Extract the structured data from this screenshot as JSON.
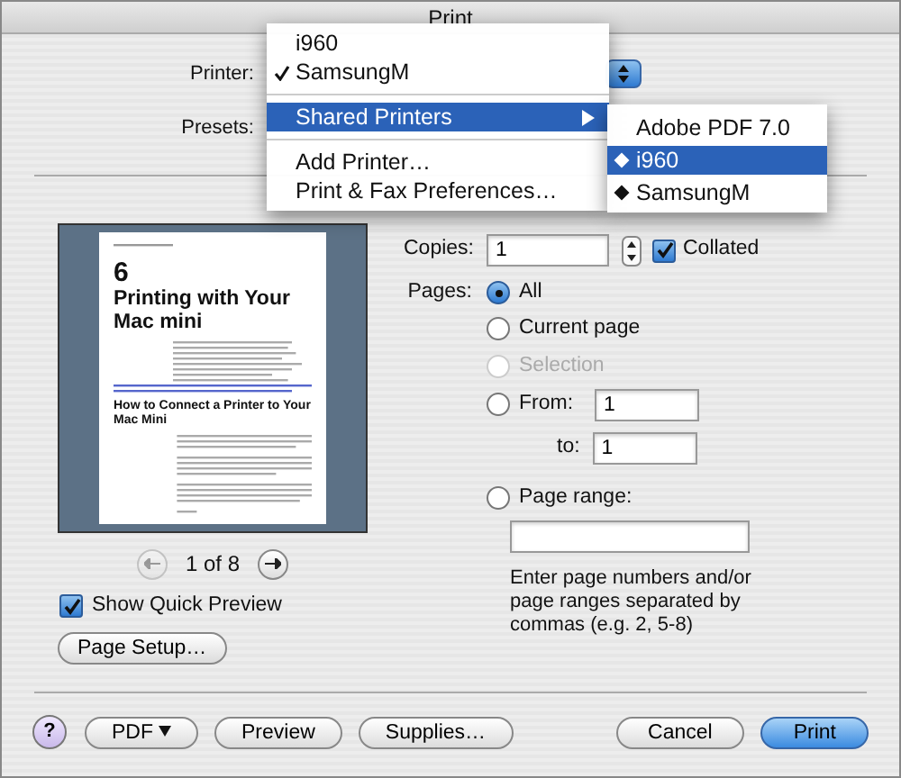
{
  "window": {
    "title": "Print"
  },
  "printer": {
    "label": "Printer:"
  },
  "presets": {
    "label": "Presets:"
  },
  "printer_menu": {
    "items": [
      {
        "kind": "item",
        "label": "i960",
        "checked": false,
        "selected": false
      },
      {
        "kind": "item",
        "label": "SamsungM",
        "checked": true,
        "selected": false
      },
      {
        "kind": "separator"
      },
      {
        "kind": "submenu",
        "label": "Shared Printers",
        "checked": false,
        "selected": true
      },
      {
        "kind": "separator"
      },
      {
        "kind": "item",
        "label": "Add Printer…",
        "checked": false,
        "selected": false
      },
      {
        "kind": "item",
        "label": "Print & Fax Preferences…",
        "checked": false,
        "selected": false
      }
    ]
  },
  "shared_menu": {
    "items": [
      {
        "label": "Adobe PDF 7.0",
        "shared": false,
        "selected": false
      },
      {
        "label": "i960",
        "shared": true,
        "selected": true
      },
      {
        "label": "SamsungM",
        "shared": true,
        "selected": false
      }
    ]
  },
  "preview": {
    "page": {
      "chapter": "6",
      "title": "Printing with Your Mac mini",
      "heading": "How to Connect a Printer to Your Mac Mini"
    },
    "page_indicator": "1 of 8",
    "prev_disabled": true,
    "next_disabled": false
  },
  "quick_preview": {
    "label": "Show Quick Preview",
    "checked": true
  },
  "page_setup_button": "Page Setup…",
  "copies": {
    "label": "Copies:",
    "value": "1"
  },
  "collated": {
    "label": "Collated",
    "checked": true
  },
  "pages": {
    "label": "Pages:",
    "options": [
      {
        "kind": "plain",
        "label": "All",
        "selected": true,
        "disabled": false
      },
      {
        "kind": "plain",
        "label": "Current page",
        "selected": false,
        "disabled": false
      },
      {
        "kind": "plain",
        "label": "Selection",
        "selected": false,
        "disabled": true
      },
      {
        "kind": "from",
        "label": "From:",
        "value": "1",
        "to_label": "to:",
        "to_value": "1",
        "selected": false,
        "disabled": false
      },
      {
        "kind": "range",
        "label": "Page range:",
        "selected": false,
        "disabled": false
      }
    ],
    "hint": "Enter page numbers and/or page ranges separated by commas (e.g. 2, 5-8)"
  },
  "help_button": "?",
  "left_buttons": [
    {
      "label": "PDF",
      "kind": "menu"
    },
    {
      "label": "Preview",
      "kind": "plain"
    },
    {
      "label": "Supplies…",
      "kind": "plain"
    }
  ],
  "right_buttons": [
    {
      "label": "Cancel",
      "default": false
    },
    {
      "label": "Print",
      "default": true
    }
  ]
}
